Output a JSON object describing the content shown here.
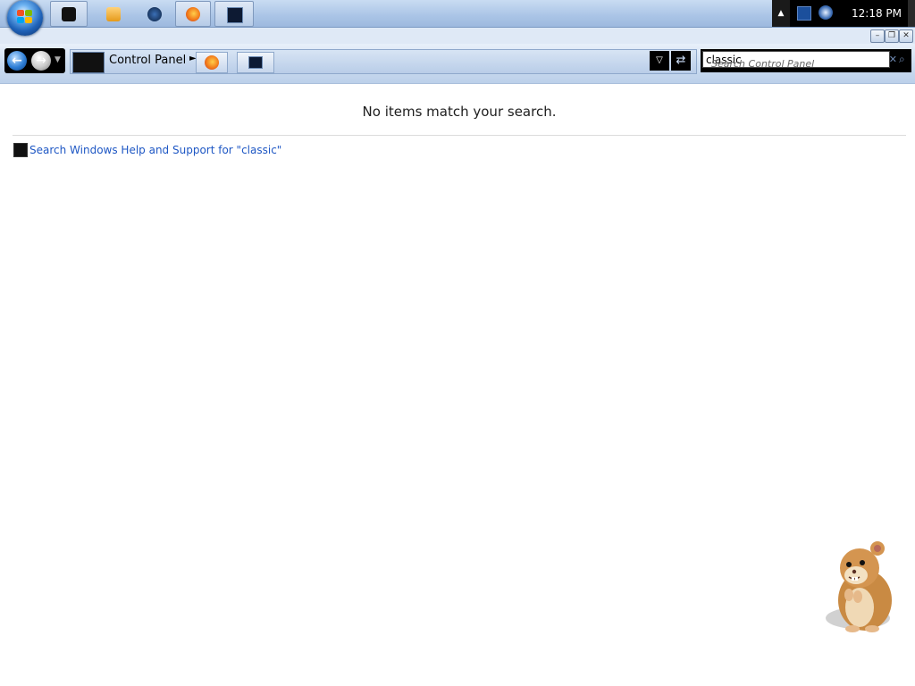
{
  "taskbar": {
    "pinned": [
      {
        "name": "explorer-window-app",
        "active": true
      },
      {
        "name": "media-player-app",
        "active": false
      },
      {
        "name": "browser-app",
        "active": false
      },
      {
        "name": "firefox-app",
        "active": true
      },
      {
        "name": "control-panel-app",
        "active": true
      }
    ],
    "tray": {
      "clock": "12:18 PM",
      "icons": [
        "network-icon",
        "volume-icon"
      ]
    }
  },
  "window": {
    "caption_buttons": {
      "minimize": "–",
      "maximize": "❐",
      "close": "✕"
    }
  },
  "address_bar": {
    "breadcrumb": [
      "Control Panel"
    ],
    "dropdown_glyph": "▽",
    "refresh_glyph": "⇄"
  },
  "search": {
    "value": "classic",
    "placeholder": "Search Control Panel",
    "clear_glyph": "✕",
    "go_glyph": "⌕"
  },
  "content": {
    "message": "No items match your search.",
    "help_link": "Search Windows Help and Support for \"classic\""
  },
  "colors": {
    "link": "#1e57c4",
    "taskbar": "#aac4e6",
    "tray": "#000000"
  }
}
